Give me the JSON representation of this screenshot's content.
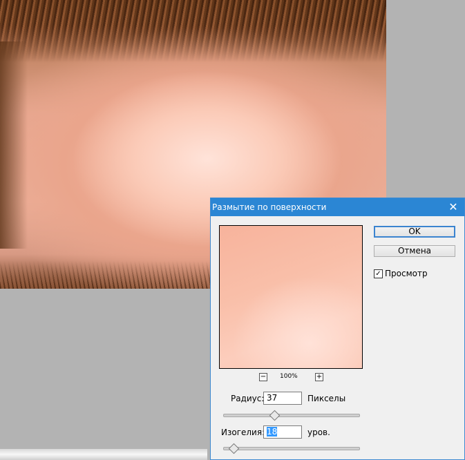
{
  "dialog": {
    "title": "Размытие по поверхности",
    "close_glyph": "✕",
    "ok_label": "OK",
    "cancel_label": "Отмена",
    "preview_label": "Просмотр",
    "preview_checked": true,
    "zoom_level": "100%",
    "zoom_out_glyph": "−",
    "zoom_in_glyph": "+",
    "radius": {
      "label": "Радиус:",
      "value": "37",
      "unit": "Пикселы",
      "slider_fraction": 0.37
    },
    "threshold": {
      "label": "Изогелия:",
      "value": "18",
      "unit": "уров.",
      "slider_fraction": 0.07
    }
  },
  "colors": {
    "titlebar": "#2b86d4",
    "dialog_bg": "#f0f0f0",
    "selection": "#3399ff"
  }
}
